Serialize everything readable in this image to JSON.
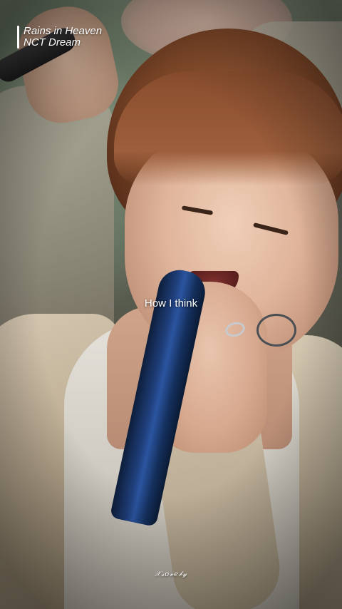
{
  "song": {
    "title": "Rains in Heaven",
    "artist": "NCT Dream"
  },
  "caption": "How I think",
  "watermark": "𝒳𝓈𝑜𝓋𝑒𝒷𝓎"
}
